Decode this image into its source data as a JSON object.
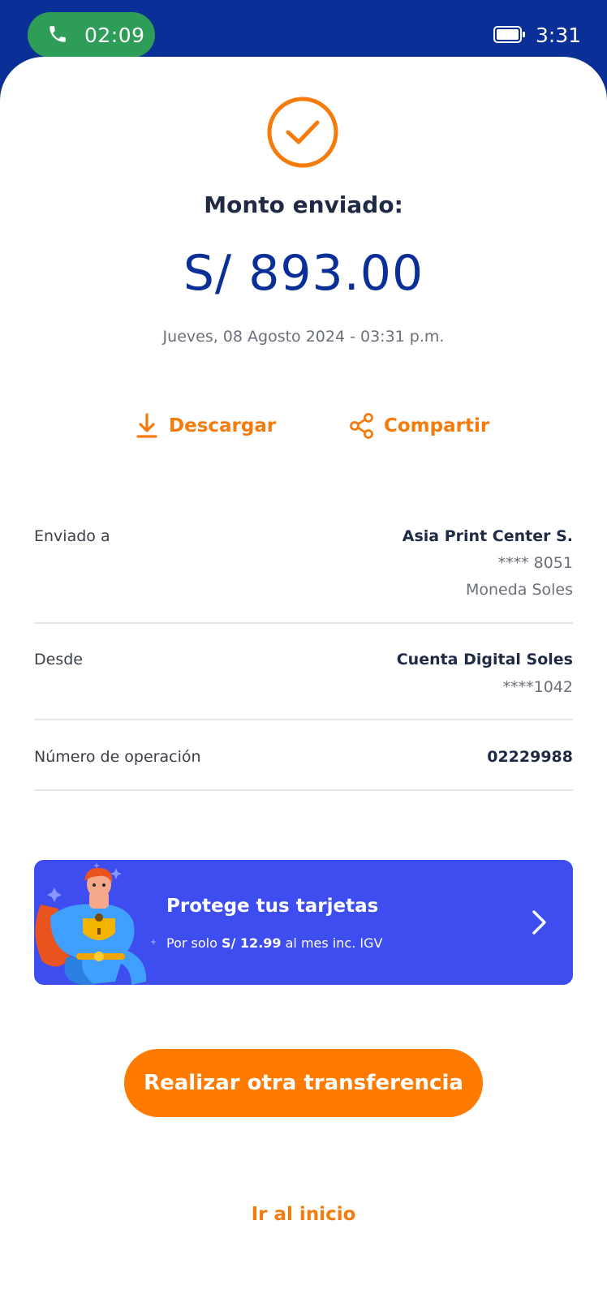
{
  "status_bar": {
    "call_timer": "02:09",
    "clock": "3:31"
  },
  "receipt": {
    "amount_label": "Monto enviado:",
    "amount": "S/ 893.00",
    "date": "Jueves, 08 Agosto 2024 - 03:31 p.m."
  },
  "actions": {
    "download_label": "Descargar",
    "share_label": "Compartir"
  },
  "details": {
    "sent_to": {
      "label": "Enviado a",
      "name": "Asia Print Center S.",
      "account": "**** 8051",
      "currency": "Moneda Soles"
    },
    "from": {
      "label": "Desde",
      "account_name": "Cuenta Digital Soles",
      "account": "****1042"
    },
    "operation": {
      "label": "Número de operación",
      "number": "02229988"
    }
  },
  "promo": {
    "title": "Protege tus tarjetas",
    "sub_prefix": "Por solo ",
    "sub_price": "S/ 12.99",
    "sub_suffix": " al mes inc. IGV"
  },
  "buttons": {
    "primary": "Realizar otra transferencia",
    "home": "Ir al inicio"
  },
  "colors": {
    "brand_blue": "#0a2f96",
    "accent_orange": "#ff7a00",
    "promo_blue": "#3d4df0",
    "call_green": "#2e9d57"
  },
  "icons": [
    "phone-icon",
    "battery-icon",
    "check-circle-icon",
    "download-icon",
    "share-icon",
    "mascot-illustration",
    "chevron-right-icon"
  ]
}
